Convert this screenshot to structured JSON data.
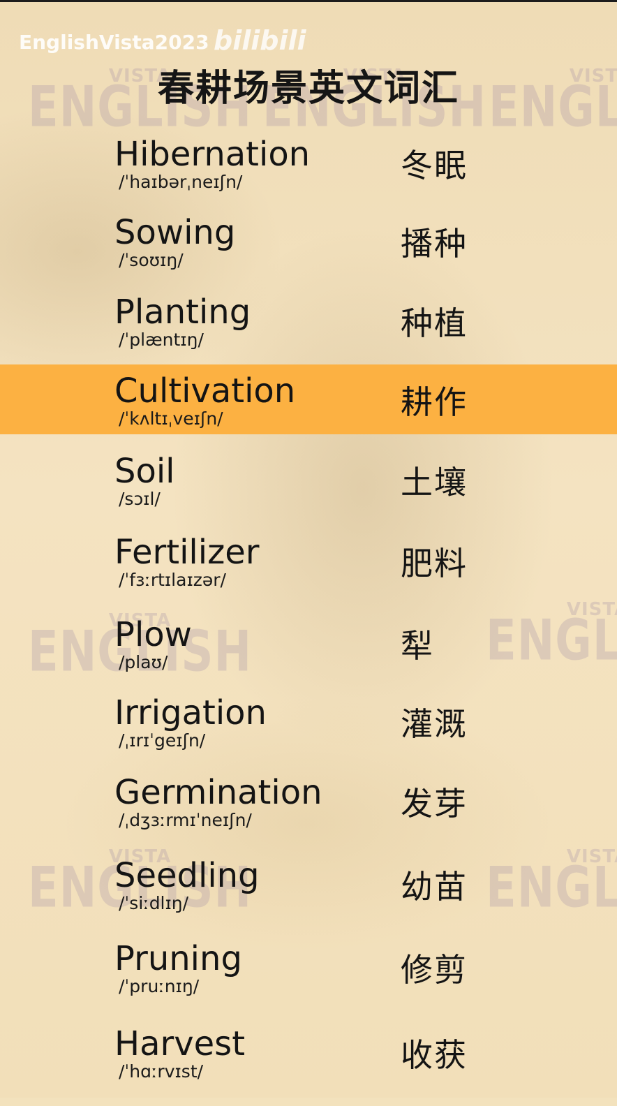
{
  "header": {
    "channel": "EnglishVista2023",
    "site_logo": "bilibili",
    "title": "春耕场景英文词汇"
  },
  "watermark": {
    "line1": "VISTA",
    "line2": "ENGLISH"
  },
  "highlight_color": "#fcb142",
  "vocab": [
    {
      "en": "Hibernation",
      "ipa": "/ˈhaɪbərˌneɪʃn/",
      "zh": "冬眠"
    },
    {
      "en": "Sowing",
      "ipa": "/ˈsoʊɪŋ/",
      "zh": "播种"
    },
    {
      "en": "Planting",
      "ipa": "/ˈplæntɪŋ/",
      "zh": "种植"
    },
    {
      "en": "Cultivation",
      "ipa": "/ˈkʌltɪˌveɪʃn/",
      "zh": "耕作",
      "highlighted": true
    },
    {
      "en": "Soil",
      "ipa": "/sɔɪl/",
      "zh": "土壤"
    },
    {
      "en": "Fertilizer",
      "ipa": "/ˈfɜːrtɪlaɪzər/",
      "zh": "肥料"
    },
    {
      "en": "Plow",
      "ipa": "/plaʊ/",
      "zh": "犁"
    },
    {
      "en": "Irrigation",
      "ipa": "/ˌɪrɪˈgeɪʃn/",
      "zh": "灌溉"
    },
    {
      "en": "Germination",
      "ipa": "/ˌdʒɜːrmɪˈneɪʃn/",
      "zh": "发芽"
    },
    {
      "en": "Seedling",
      "ipa": "/ˈsiːdlɪŋ/",
      "zh": "幼苗"
    },
    {
      "en": "Pruning",
      "ipa": "/ˈpruːnɪŋ/",
      "zh": "修剪"
    },
    {
      "en": "Harvest",
      "ipa": "/ˈhɑːrvɪst/",
      "zh": "收获"
    }
  ]
}
